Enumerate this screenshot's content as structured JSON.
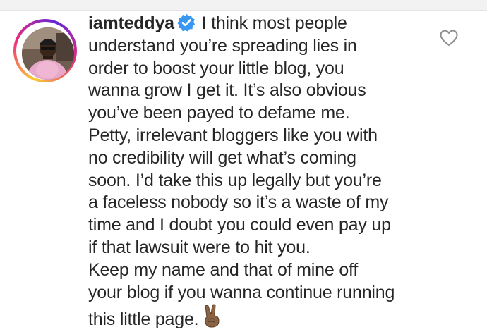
{
  "comment": {
    "username": "iamteddya",
    "verified": true,
    "lines": [
      "I think most people",
      "understand you’re spreading lies in",
      "order to boost your little blog, you",
      "wanna grow I get it. It’s also obvious",
      "you’ve been payed to defame me.",
      "Petty, irrelevant bloggers like you with",
      "no credibility will get what’s coming",
      "soon. I’d take this up legally but you’re",
      "a faceless nobody so it’s a waste of my",
      "time and I doubt you could even pay up",
      "if that lawsuit were to hit you.",
      "Keep my name and that of mine off",
      "your blog if you wanna continue running",
      "this little page."
    ],
    "emoji": "victory-hand-emoji",
    "like_icon": "heart-outline-icon",
    "avatar_icon": "user-avatar",
    "colors": {
      "verified": "#3897f0",
      "text": "#262626",
      "icon": "#8e8e8e"
    }
  }
}
